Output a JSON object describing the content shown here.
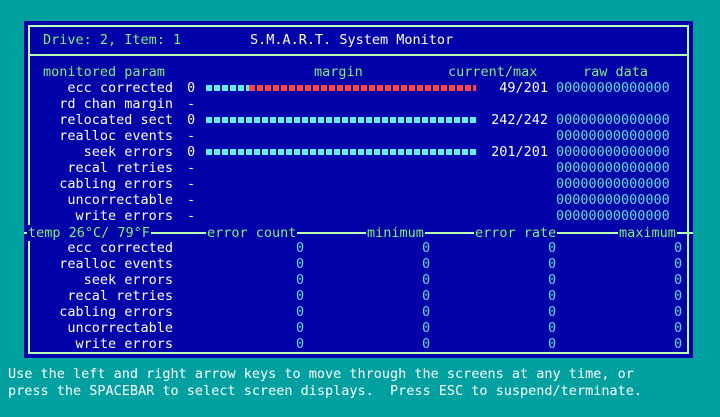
{
  "header": {
    "drive_item": "Drive: 2, Item: 1",
    "title": "S.M.A.R.T. System Monitor"
  },
  "columns": {
    "param": "monitored param",
    "margin": "margin",
    "current_max": "current/max",
    "raw_data": "raw data"
  },
  "monitored": [
    {
      "label": "ecc corrected",
      "marker": "0",
      "bar_cyan_fraction": 0.16,
      "bar_red_fraction": 0.84,
      "current_max": "49/201",
      "raw": "00000000000000"
    },
    {
      "label": "rd chan margin",
      "marker": "-",
      "current_max": "",
      "raw": ""
    },
    {
      "label": "relocated sect",
      "marker": "0",
      "bar_cyan_fraction": 1.0,
      "bar_red_fraction": 0.0,
      "current_max": "242/242",
      "raw": "00000000000000"
    },
    {
      "label": "realloc events",
      "marker": "-",
      "current_max": "",
      "raw": "00000000000000"
    },
    {
      "label": "seek errors",
      "marker": "0",
      "bar_cyan_fraction": 1.0,
      "bar_red_fraction": 0.0,
      "current_max": "201/201",
      "raw": "00000000000000"
    },
    {
      "label": "recal retries",
      "marker": "-",
      "current_max": "",
      "raw": "00000000000000"
    },
    {
      "label": "cabling errors",
      "marker": "-",
      "current_max": "",
      "raw": "00000000000000"
    },
    {
      "label": "uncorrectable",
      "marker": "-",
      "current_max": "",
      "raw": "00000000000000"
    },
    {
      "label": "write errors",
      "marker": "-",
      "current_max": "",
      "raw": "00000000000000"
    }
  ],
  "temp_divider": {
    "temp": "temp 26°C/ 79°F",
    "error_count": "error count",
    "minimum": "minimum",
    "error_rate": "error rate",
    "maximum": "maximum"
  },
  "errors": [
    {
      "label": "ecc corrected",
      "error_count": "0",
      "minimum": "0",
      "error_rate": "0",
      "maximum": "0"
    },
    {
      "label": "realloc events",
      "error_count": "0",
      "minimum": "0",
      "error_rate": "0",
      "maximum": "0"
    },
    {
      "label": "seek errors",
      "error_count": "0",
      "minimum": "0",
      "error_rate": "0",
      "maximum": "0"
    },
    {
      "label": "recal retries",
      "error_count": "0",
      "minimum": "0",
      "error_rate": "0",
      "maximum": "0"
    },
    {
      "label": "cabling errors",
      "error_count": "0",
      "minimum": "0",
      "error_rate": "0",
      "maximum": "0"
    },
    {
      "label": "uncorrectable",
      "error_count": "0",
      "minimum": "0",
      "error_rate": "0",
      "maximum": "0"
    },
    {
      "label": "write errors",
      "error_count": "0",
      "minimum": "0",
      "error_rate": "0",
      "maximum": "0"
    }
  ],
  "help": {
    "line1": "Use the left and right arrow keys to move through the screens at any time, or",
    "line2": "press the SPACEBAR to select screen displays.  Press ESC to suspend/terminate."
  },
  "colors": {
    "background": "#00a0a0",
    "panel": "#0000a8",
    "frame": "#b8ffb8",
    "label_green": "#7cf07c",
    "bar_cyan": "#5cf0f0",
    "bar_red": "#ff4444"
  }
}
